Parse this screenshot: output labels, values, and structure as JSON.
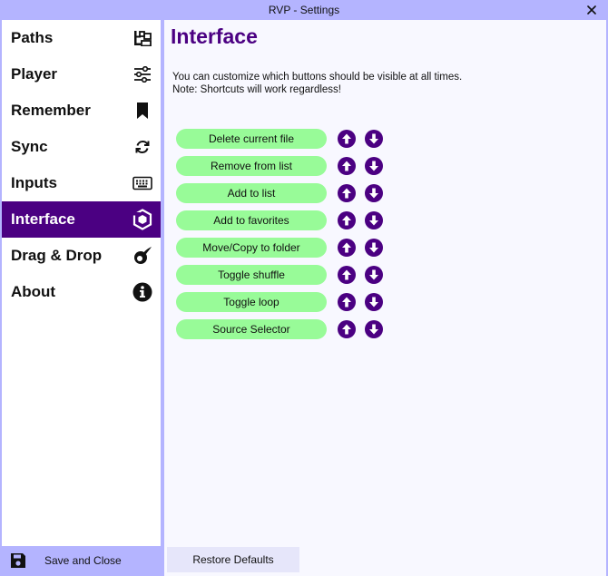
{
  "window": {
    "title": "RVP - Settings"
  },
  "sidebar": {
    "items": [
      {
        "label": "Paths",
        "icon": "folder-tree-icon"
      },
      {
        "label": "Player",
        "icon": "sliders-icon"
      },
      {
        "label": "Remember",
        "icon": "bookmark-icon"
      },
      {
        "label": "Sync",
        "icon": "sync-icon"
      },
      {
        "label": "Inputs",
        "icon": "keyboard-icon"
      },
      {
        "label": "Interface",
        "icon": "cube-icon",
        "active": true
      },
      {
        "label": "Drag & Drop",
        "icon": "comet-icon"
      },
      {
        "label": "About",
        "icon": "info-icon"
      }
    ],
    "save_label": "Save and Close"
  },
  "main": {
    "title": "Interface",
    "description_line1": "You can customize which buttons should be visible at all times.",
    "description_line2": "Note: Shortcuts will work regardless!",
    "buttons": [
      "Delete current file",
      "Remove from list",
      "Add to list",
      "Add to favorites",
      "Move/Copy to folder",
      "Toggle shuffle",
      "Toggle loop",
      "Source Selector"
    ],
    "restore_label": "Restore Defaults"
  },
  "colors": {
    "accent": "#4b0082",
    "chrome": "#b4b4ff",
    "pill": "#98fb98",
    "panel": "#f8f8ff",
    "restore": "#e6e6fa"
  }
}
